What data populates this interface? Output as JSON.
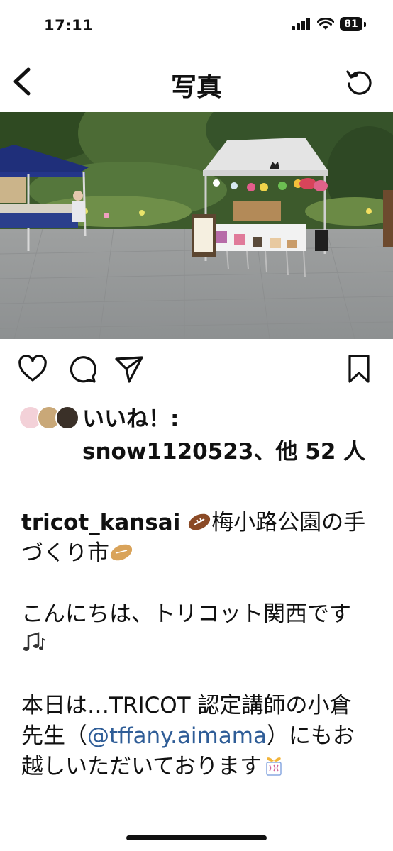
{
  "status_bar": {
    "time": "17:11",
    "battery": "81"
  },
  "nav": {
    "title": "写真",
    "back_icon": "chevron-left-icon",
    "refresh_icon": "refresh-icon"
  },
  "post": {
    "likes_prefix": "いいね！:",
    "likes_user": "snow1120523",
    "likes_suffix": "、他 52 人",
    "username": "tricot_kansai",
    "caption_line1_text": "梅小路公園の手づくり市",
    "greeting": "こんにちは、トリコット関西です",
    "body_prefix": "本日は…TRICOT 認定講師の小倉先生（",
    "mention": "@tffany.aimama",
    "body_suffix": "）にもお越しいただいております"
  },
  "actions": {
    "like_icon": "heart-icon",
    "comment_icon": "comment-icon",
    "share_icon": "send-icon",
    "save_icon": "bookmark-icon"
  },
  "colors": {
    "mention": "#2f5d97",
    "text": "#111111",
    "background": "#ffffff"
  }
}
